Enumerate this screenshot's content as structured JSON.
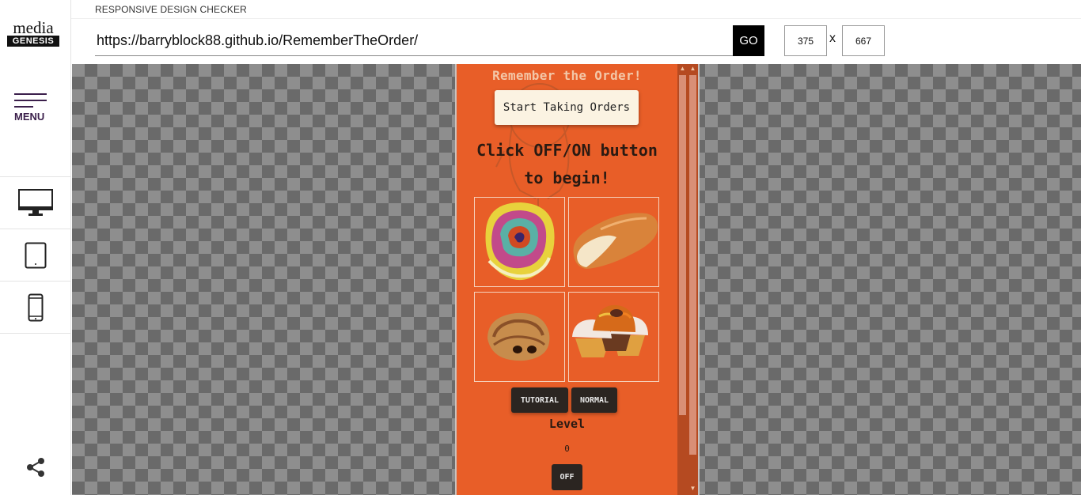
{
  "brand": {
    "line1": "media",
    "line2": "GENESIS"
  },
  "sidebar": {
    "menu_label": "MENU",
    "devices": [
      {
        "name": "desktop-icon"
      },
      {
        "name": "tablet-icon"
      },
      {
        "name": "phone-icon"
      }
    ],
    "share_icon": "share-icon"
  },
  "header": {
    "title": "RESPONSIVE DESIGN CHECKER",
    "url": "https://barryblock88.github.io/RememberTheOrder/",
    "go_label": "GO",
    "width_value": "375",
    "height_value": "667",
    "x_label": "x"
  },
  "app": {
    "title": "Remember the Order!",
    "start_label": "Start Taking Orders",
    "prompt_line1": "Click OFF/ON button",
    "prompt_line2": "to begin!",
    "tiles": [
      {
        "name": "cinnamon-roll"
      },
      {
        "name": "bread-roll"
      },
      {
        "name": "pain-au-chocolat"
      },
      {
        "name": "cupcakes"
      }
    ],
    "tutorial_label": "TUTORIAL",
    "normal_label": "NORMAL",
    "level_label": "Level",
    "level_value": "0",
    "onoff_label": "OFF"
  },
  "colors": {
    "app_bg": "#e85e28",
    "button_dark": "#2b2521",
    "sidebar_accent": "#3b1f4b"
  }
}
